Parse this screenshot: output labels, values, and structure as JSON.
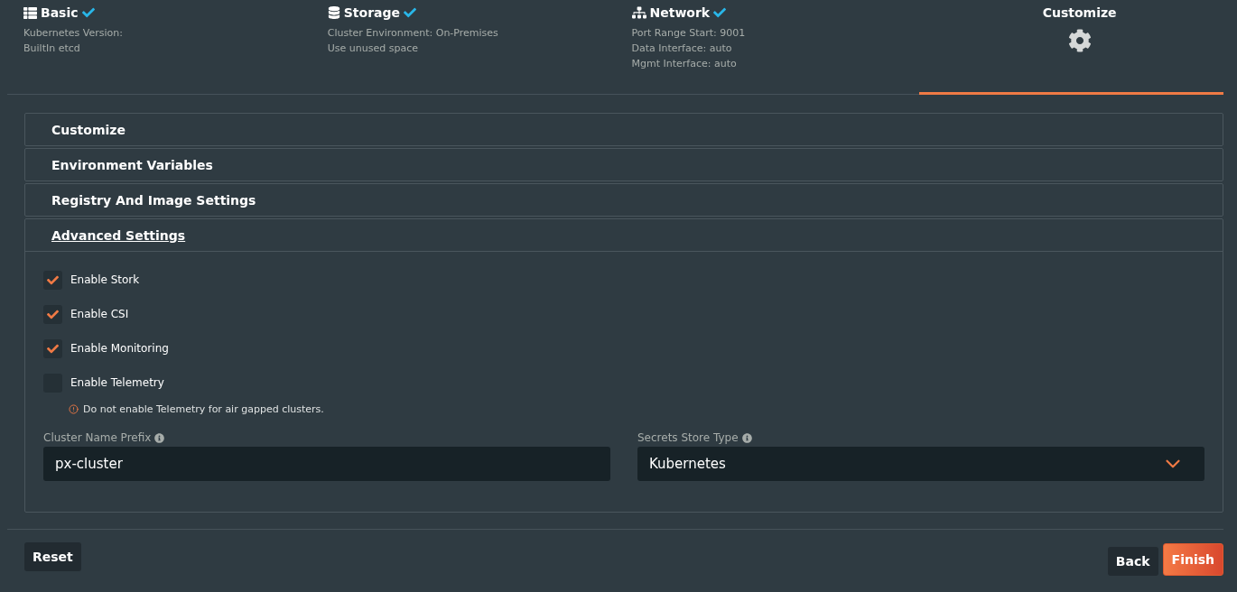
{
  "steps": [
    {
      "kind": "list",
      "title": "Basic",
      "done": true,
      "selected": false,
      "lines": [
        "Kubernetes Version:",
        "BuiltIn etcd"
      ]
    },
    {
      "kind": "database",
      "title": "Storage",
      "done": true,
      "selected": false,
      "lines": [
        "Cluster Environment: On-Premises",
        "Use unused space"
      ]
    },
    {
      "kind": "network",
      "title": "Network",
      "done": true,
      "selected": false,
      "lines": [
        "Port Range Start: 9001",
        "Data Interface: auto",
        "Mgmt Interface: auto"
      ]
    },
    {
      "kind": "gear",
      "title": "Customize",
      "done": false,
      "selected": true
    }
  ],
  "sections": [
    {
      "title": "Customize",
      "expanded": false
    },
    {
      "title": "Environment Variables",
      "expanded": false
    },
    {
      "title": "Registry And Image Settings",
      "expanded": false
    },
    {
      "title": "Advanced Settings",
      "expanded": true
    }
  ],
  "options": [
    {
      "label": "Enable Stork",
      "checked": true
    },
    {
      "label": "Enable CSI",
      "checked": true
    },
    {
      "label": "Enable Monitoring",
      "checked": true
    },
    {
      "label": "Enable Telemetry",
      "checked": false
    }
  ],
  "note": "Do not enable Telemetry for air gapped clusters.",
  "fields": [
    {
      "kind": "text",
      "label": "Cluster Name Prefix",
      "value": "px-cluster"
    },
    {
      "kind": "select",
      "label": "Secrets Store Type",
      "value": "Kubernetes"
    }
  ],
  "buttons": {
    "reset": "Reset",
    "back": "Back",
    "finish": "Finish"
  }
}
